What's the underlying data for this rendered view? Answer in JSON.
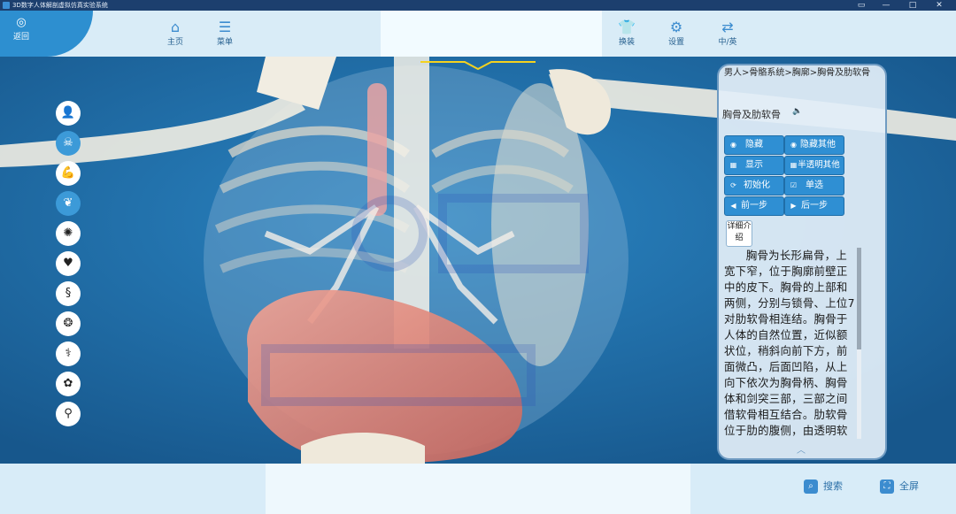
{
  "window": {
    "title": "3D数字人体解剖虚拟仿真实验系统",
    "controls": {
      "icon": "window-icon",
      "minimize": "—",
      "maximize": "□",
      "close": "✕"
    }
  },
  "topbar": {
    "back": {
      "label": "返回",
      "icon": "eye-icon"
    },
    "nav": [
      {
        "label": "主页",
        "icon": "home-icon"
      },
      {
        "label": "菜单",
        "icon": "menu-icon"
      },
      {
        "label": "换装",
        "icon": "shirt-icon"
      },
      {
        "label": "设置",
        "icon": "gear-icon"
      },
      {
        "label": "中/英",
        "icon": "language-icon"
      }
    ]
  },
  "sidebar": {
    "systems": [
      {
        "name": "body-silhouette-icon",
        "glyph": "👤",
        "active": false
      },
      {
        "name": "skeleton-icon",
        "glyph": "🦴",
        "active": true
      },
      {
        "name": "muscle-icon",
        "glyph": "💪",
        "active": false
      },
      {
        "name": "lungs-icon",
        "glyph": "🫁",
        "active": false
      },
      {
        "name": "brain-icon",
        "glyph": "🧠",
        "active": false
      },
      {
        "name": "heart-icon",
        "glyph": "♥",
        "active": false
      },
      {
        "name": "intestine-icon",
        "glyph": "§",
        "active": false
      },
      {
        "name": "kidney-icon",
        "glyph": "❂",
        "active": false
      },
      {
        "name": "vessel-icon",
        "glyph": "⚕",
        "active": false
      },
      {
        "name": "thyroid-icon",
        "glyph": "✿",
        "active": false
      },
      {
        "name": "reproductive-icon",
        "glyph": "⚲",
        "active": false
      }
    ]
  },
  "panel": {
    "breadcrumb": "男人>骨骼系统>胸廓>胸骨及肋软骨",
    "title": "胸骨及肋软骨",
    "speaker_icon": "🔈",
    "buttons": {
      "hide": {
        "label": "隐藏",
        "icon": "eye-slash-icon"
      },
      "hide_others": {
        "label": "隐藏其他",
        "icon": "eye-slash-icon"
      },
      "show": {
        "label": "显示",
        "icon": "grid-icon"
      },
      "translucent_others": {
        "label": "半透明其他",
        "icon": "grid-icon"
      },
      "reset": {
        "label": "初始化",
        "icon": "reset-icon"
      },
      "single_select": {
        "label": "单选",
        "icon": "checkbox-icon"
      },
      "prev": {
        "label": "前一步",
        "icon": "arrow-left-icon"
      },
      "next": {
        "label": "后一步",
        "icon": "arrow-right-icon"
      }
    },
    "detail_label": "详细介绍",
    "description": "胸骨为长形扁骨，上宽下窄，位于胸廓前壁正中的皮下。胸骨的上部和两侧，分别与锁骨、上位7对肋软骨相连结。胸骨于人体的自然位置，近似额状位，稍斜向前下方，前面微凸，后面凹陷，从上向下依次为胸骨柄、胸骨体和剑突三部，三部之间借软骨相互结合。肋软骨位于肋的腹侧，由透明软骨构成，分左右"
  },
  "bottombar": {
    "search": {
      "label": "搜索",
      "icon": "search-icon"
    },
    "fullscreen": {
      "label": "全屏",
      "icon": "fullscreen-icon"
    }
  },
  "colors": {
    "accent": "#2f8fd3",
    "stage_bg": "#1e6aa4",
    "bone": "#f1ede2",
    "stomach": "#e58678"
  }
}
